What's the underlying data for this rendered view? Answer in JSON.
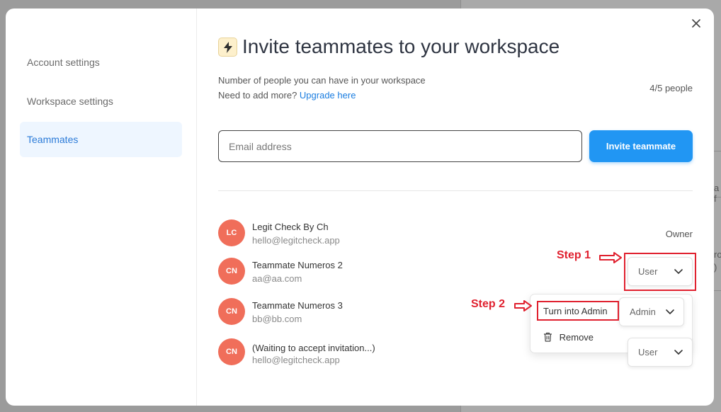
{
  "background": {
    "fragments": [
      "a f",
      "ro",
      ")"
    ]
  },
  "sidebar": {
    "items": [
      {
        "label": "Account settings"
      },
      {
        "label": "Workspace settings"
      },
      {
        "label": "Teammates"
      }
    ]
  },
  "header": {
    "title": "Invite teammates to your workspace",
    "icon": "lightning-bolt-icon"
  },
  "capacity": {
    "line1": "Number of people you can have in your workspace",
    "line2_prefix": "Need to add more?",
    "upgrade_link": "Upgrade here",
    "count": "4/5 people"
  },
  "invite": {
    "placeholder": "Email address",
    "button_label": "Invite teammate"
  },
  "members": [
    {
      "initials": "LC",
      "name": "Legit Check By Ch",
      "email": "hello@legitcheck.app",
      "role": "Owner"
    },
    {
      "initials": "CN",
      "name": "Teammate Numeros 2",
      "email": "aa@aa.com",
      "role": "User"
    },
    {
      "initials": "CN",
      "name": "Teammate Numeros 3",
      "email": "bb@bb.com",
      "role": "Admin"
    },
    {
      "initials": "CN",
      "name": "(Waiting to accept invitation...)",
      "email": "hello@legitcheck.app",
      "role": "User"
    }
  ],
  "dropdown": {
    "items": [
      "Turn into Admin",
      "Remove"
    ]
  },
  "annotations": {
    "step1": "Step 1",
    "step2": "Step 2",
    "color": "#e0212f"
  },
  "colors": {
    "accent": "#2196f3",
    "avatar": "#f06e5a",
    "active_nav_bg": "#eef6ff"
  }
}
